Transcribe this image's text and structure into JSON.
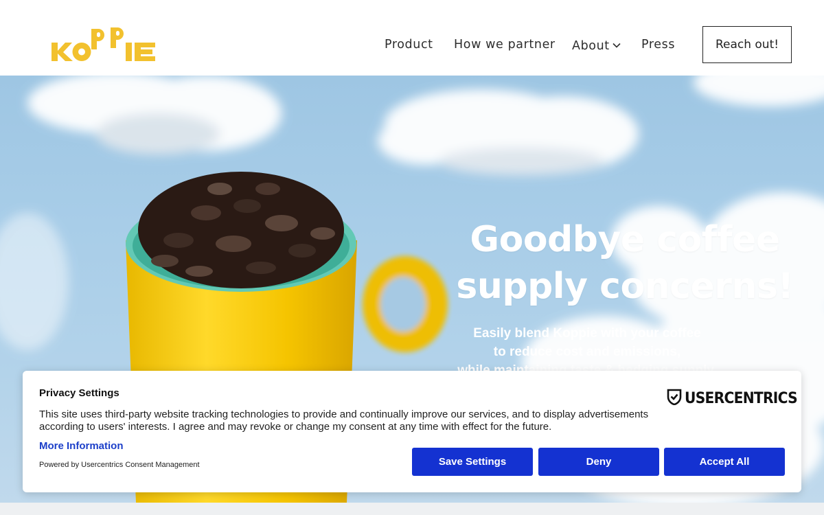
{
  "header": {
    "logo_text": "KOPPIE",
    "nav": {
      "product": "Product",
      "partner": "How we partner",
      "about": "About",
      "press": "Press"
    },
    "cta_label": "Reach out!"
  },
  "hero": {
    "headline_line1": "Goodbye coffee",
    "headline_line2": "supply concerns!",
    "sub_line1": "Easily blend Koppie with your coffee",
    "sub_line2": "to reduce cost and emissions,",
    "sub_line3": "while maintaining taste & hedging supply."
  },
  "consent": {
    "title": "Privacy Settings",
    "text": "This site uses third-party website tracking technologies to provide and continually improve our services, and to display advertisements according to users' interests. I agree and may revoke or change my consent at any time with effect for the future.",
    "more_info": "More Information",
    "powered_by": "Powered by Usercentrics Consent Management",
    "brand": "USERCENTRICS",
    "buttons": {
      "save": "Save Settings",
      "deny": "Deny",
      "accept": "Accept All"
    }
  },
  "colors": {
    "brand_yellow": "#f2c12e",
    "button_blue": "#1432d1",
    "link_blue": "#1c3fc9",
    "sky": "#a8cde8"
  },
  "icons": [
    "chevron-down-icon",
    "usercentrics-shield-icon"
  ]
}
